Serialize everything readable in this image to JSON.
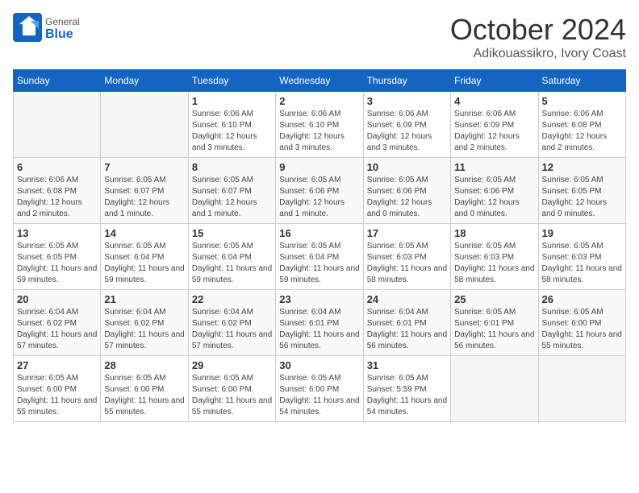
{
  "logo": {
    "general": "General",
    "blue": "Blue"
  },
  "header": {
    "month": "October 2024",
    "location": "Adikouassikro, Ivory Coast"
  },
  "weekdays": [
    "Sunday",
    "Monday",
    "Tuesday",
    "Wednesday",
    "Thursday",
    "Friday",
    "Saturday"
  ],
  "weeks": [
    [
      {
        "day": "",
        "info": ""
      },
      {
        "day": "",
        "info": ""
      },
      {
        "day": "1",
        "info": "Sunrise: 6:06 AM\nSunset: 6:10 PM\nDaylight: 12 hours and 3 minutes."
      },
      {
        "day": "2",
        "info": "Sunrise: 6:06 AM\nSunset: 6:10 PM\nDaylight: 12 hours and 3 minutes."
      },
      {
        "day": "3",
        "info": "Sunrise: 6:06 AM\nSunset: 6:09 PM\nDaylight: 12 hours and 3 minutes."
      },
      {
        "day": "4",
        "info": "Sunrise: 6:06 AM\nSunset: 6:09 PM\nDaylight: 12 hours and 2 minutes."
      },
      {
        "day": "5",
        "info": "Sunrise: 6:06 AM\nSunset: 6:08 PM\nDaylight: 12 hours and 2 minutes."
      }
    ],
    [
      {
        "day": "6",
        "info": "Sunrise: 6:06 AM\nSunset: 6:08 PM\nDaylight: 12 hours and 2 minutes."
      },
      {
        "day": "7",
        "info": "Sunrise: 6:05 AM\nSunset: 6:07 PM\nDaylight: 12 hours and 1 minute."
      },
      {
        "day": "8",
        "info": "Sunrise: 6:05 AM\nSunset: 6:07 PM\nDaylight: 12 hours and 1 minute."
      },
      {
        "day": "9",
        "info": "Sunrise: 6:05 AM\nSunset: 6:06 PM\nDaylight: 12 hours and 1 minute."
      },
      {
        "day": "10",
        "info": "Sunrise: 6:05 AM\nSunset: 6:06 PM\nDaylight: 12 hours and 0 minutes."
      },
      {
        "day": "11",
        "info": "Sunrise: 6:05 AM\nSunset: 6:06 PM\nDaylight: 12 hours and 0 minutes."
      },
      {
        "day": "12",
        "info": "Sunrise: 6:05 AM\nSunset: 6:05 PM\nDaylight: 12 hours and 0 minutes."
      }
    ],
    [
      {
        "day": "13",
        "info": "Sunrise: 6:05 AM\nSunset: 6:05 PM\nDaylight: 11 hours and 59 minutes."
      },
      {
        "day": "14",
        "info": "Sunrise: 6:05 AM\nSunset: 6:04 PM\nDaylight: 11 hours and 59 minutes."
      },
      {
        "day": "15",
        "info": "Sunrise: 6:05 AM\nSunset: 6:04 PM\nDaylight: 11 hours and 59 minutes."
      },
      {
        "day": "16",
        "info": "Sunrise: 6:05 AM\nSunset: 6:04 PM\nDaylight: 11 hours and 59 minutes."
      },
      {
        "day": "17",
        "info": "Sunrise: 6:05 AM\nSunset: 6:03 PM\nDaylight: 11 hours and 58 minutes."
      },
      {
        "day": "18",
        "info": "Sunrise: 6:05 AM\nSunset: 6:03 PM\nDaylight: 11 hours and 58 minutes."
      },
      {
        "day": "19",
        "info": "Sunrise: 6:05 AM\nSunset: 6:03 PM\nDaylight: 11 hours and 58 minutes."
      }
    ],
    [
      {
        "day": "20",
        "info": "Sunrise: 6:04 AM\nSunset: 6:02 PM\nDaylight: 11 hours and 57 minutes."
      },
      {
        "day": "21",
        "info": "Sunrise: 6:04 AM\nSunset: 6:02 PM\nDaylight: 11 hours and 57 minutes."
      },
      {
        "day": "22",
        "info": "Sunrise: 6:04 AM\nSunset: 6:02 PM\nDaylight: 11 hours and 57 minutes."
      },
      {
        "day": "23",
        "info": "Sunrise: 6:04 AM\nSunset: 6:01 PM\nDaylight: 11 hours and 56 minutes."
      },
      {
        "day": "24",
        "info": "Sunrise: 6:04 AM\nSunset: 6:01 PM\nDaylight: 11 hours and 56 minutes."
      },
      {
        "day": "25",
        "info": "Sunrise: 6:05 AM\nSunset: 6:01 PM\nDaylight: 11 hours and 56 minutes."
      },
      {
        "day": "26",
        "info": "Sunrise: 6:05 AM\nSunset: 6:00 PM\nDaylight: 11 hours and 55 minutes."
      }
    ],
    [
      {
        "day": "27",
        "info": "Sunrise: 6:05 AM\nSunset: 6:00 PM\nDaylight: 11 hours and 55 minutes."
      },
      {
        "day": "28",
        "info": "Sunrise: 6:05 AM\nSunset: 6:00 PM\nDaylight: 11 hours and 55 minutes."
      },
      {
        "day": "29",
        "info": "Sunrise: 6:05 AM\nSunset: 6:00 PM\nDaylight: 11 hours and 55 minutes."
      },
      {
        "day": "30",
        "info": "Sunrise: 6:05 AM\nSunset: 6:00 PM\nDaylight: 11 hours and 54 minutes."
      },
      {
        "day": "31",
        "info": "Sunrise: 6:05 AM\nSunset: 5:59 PM\nDaylight: 11 hours and 54 minutes."
      },
      {
        "day": "",
        "info": ""
      },
      {
        "day": "",
        "info": ""
      }
    ]
  ]
}
